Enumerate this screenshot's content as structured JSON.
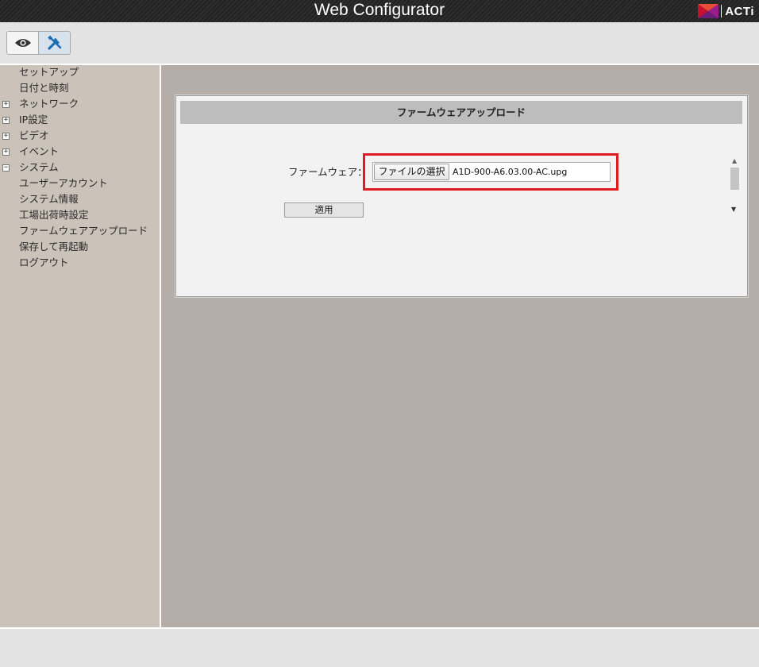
{
  "header": {
    "title": "Web Configurator",
    "logo_text": "ACTi"
  },
  "toolbar": {
    "buttons": [
      {
        "icon": "eye-icon",
        "name": "live-view"
      },
      {
        "icon": "tools-icon",
        "name": "setup",
        "active": true
      }
    ]
  },
  "sidebar": {
    "items": [
      {
        "label": "セットアップ",
        "expander": ""
      },
      {
        "label": "日付と時刻",
        "expander": ""
      },
      {
        "label": "ネットワーク",
        "expander": "+"
      },
      {
        "label": "IP設定",
        "expander": "+"
      },
      {
        "label": "ビデオ",
        "expander": "+"
      },
      {
        "label": "イベント",
        "expander": "+"
      },
      {
        "label": "システム",
        "expander": "−"
      },
      {
        "label": "ユーザーアカウント",
        "expander": ""
      },
      {
        "label": "システム情報",
        "expander": ""
      },
      {
        "label": "工場出荷時設定",
        "expander": ""
      },
      {
        "label": "ファームウェアアップロード",
        "expander": ""
      },
      {
        "label": "保存して再起動",
        "expander": ""
      },
      {
        "label": "ログアウト",
        "expander": ""
      }
    ]
  },
  "panel": {
    "title": "ファームウェアアップロード",
    "firmware_label": "ファームウェア：",
    "choose_file_label": "ファイルの選択",
    "file_name": "A1D-900-A6.03.00-AC.upg",
    "apply_label": "適用"
  },
  "colors": {
    "highlight": "#e11b22",
    "sidebar_bg": "#cbc2b9",
    "main_bg": "#b5ada7"
  }
}
